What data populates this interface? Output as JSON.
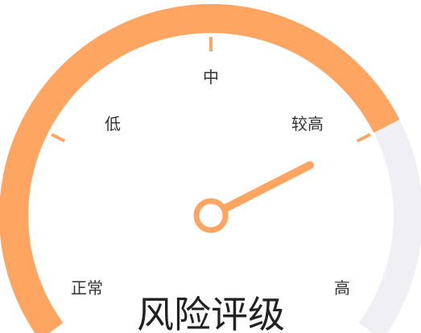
{
  "chart_data": {
    "type": "gauge",
    "title": "风险评级",
    "min_label": "正常",
    "max_label": "高",
    "levels": [
      "正常",
      "低",
      "中",
      "较高",
      "高"
    ],
    "value_fraction": 0.75,
    "colors": {
      "progress": "#FFA562",
      "track": "#F0F0F4",
      "pointer": "#FFA562",
      "label_text": "#333333",
      "title_text": "#222222"
    }
  }
}
